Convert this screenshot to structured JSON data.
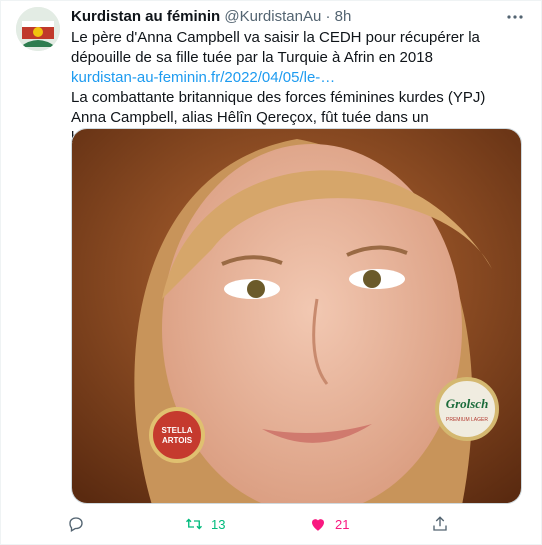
{
  "author": {
    "name": "Kurdistan au féminin",
    "handle": "@KurdistanAu",
    "separator": "·",
    "time": "8h"
  },
  "tweet": {
    "line1": "Le père d'Anna Campbell va saisir la CEDH pour récupérer la dépouille de sa fille tuée par la Turquie à Afrin en 2018",
    "link": "kurdistan-au-feminin.fr/2022/04/05/le-…",
    "line2": "La combattante britannique des forces féminines kurdes (YPJ) Anna Campbell, alias Hêlîn Qereçox, fût tuée dans un bombardement turc…"
  },
  "media": {
    "earring_left_lines": [
      "STELLA",
      "ARTOIS"
    ],
    "earring_right_text": "Grolsch",
    "earring_right_sub": "PREMIUM LAGER"
  },
  "actions": {
    "replies": "",
    "retweets": "13",
    "likes": "21"
  },
  "icons": [
    "more-icon",
    "reply-icon",
    "retweet-icon",
    "heart-icon",
    "share-icon"
  ],
  "colors": {
    "link": "#1d9bf0",
    "retweet": "#00ba7c",
    "like": "#f91880",
    "muted": "#536471"
  }
}
